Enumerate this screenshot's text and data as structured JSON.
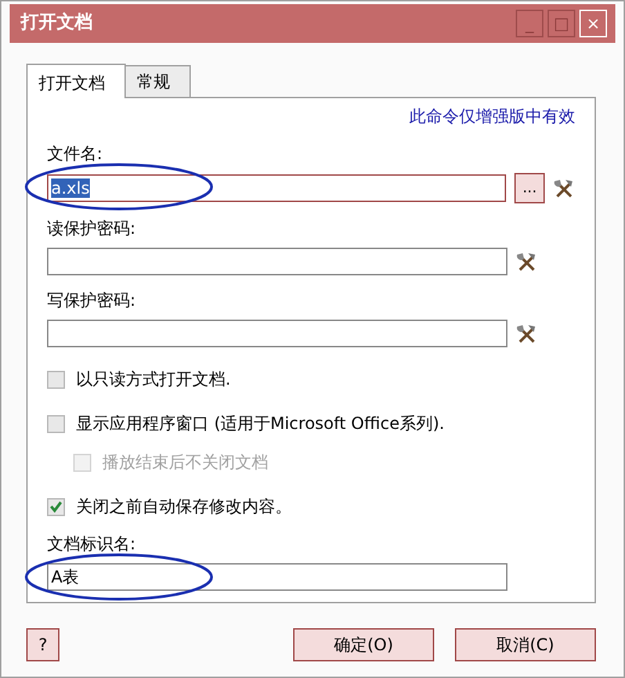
{
  "window": {
    "title": "打开文档",
    "controls": [
      "_",
      "□",
      "×"
    ]
  },
  "tabs": [
    {
      "label": "打开文档",
      "selected": true
    },
    {
      "label": "常规",
      "selected": false
    }
  ],
  "notice": "此命令仅增强版中有效",
  "fields": [
    {
      "label": "文件名:",
      "value": "a.xls",
      "value_selected": true,
      "browse": "...",
      "tool": true,
      "highlighted": true,
      "accent": true
    },
    {
      "label": "读保护密码:",
      "tool": true
    },
    {
      "label": "写保护密码:",
      "tool": true
    }
  ],
  "options": [
    {
      "label": "以只读方式打开文档.",
      "checked": false,
      "disabled": false
    },
    {
      "label": "显示应用程序窗口 (适用于Microsoft Office系列).",
      "checked": false,
      "disabled": false,
      "children": [
        {
          "label": "播放结束后不关闭文档",
          "checked": false,
          "disabled": true
        }
      ]
    },
    {
      "label": "关闭之前自动保存修改内容。",
      "checked": true,
      "disabled": false
    }
  ],
  "doc_name": {
    "label": "文档标识名:",
    "value": "A表",
    "highlighted": true
  },
  "buttons": {
    "help": "?",
    "ok": "确定(O)",
    "cancel": "取消(C)"
  }
}
